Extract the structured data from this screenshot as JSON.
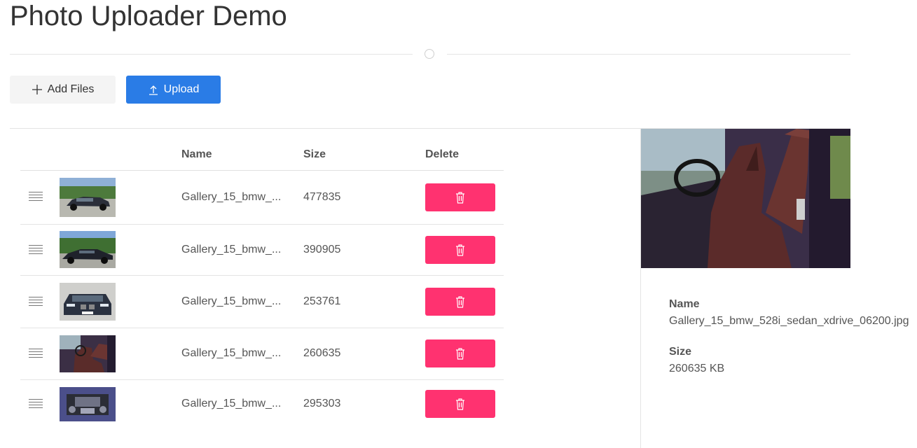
{
  "page": {
    "title": "Photo Uploader Demo"
  },
  "toolbar": {
    "add_label": "Add Files",
    "upload_label": "Upload"
  },
  "table": {
    "headers": {
      "name": "Name",
      "size": "Size",
      "delete": "Delete"
    },
    "rows": [
      {
        "name": "Gallery_15_bmw_...",
        "size": "477835",
        "thumb": "car-exterior-front-three-quarter"
      },
      {
        "name": "Gallery_15_bmw_...",
        "size": "390905",
        "thumb": "car-exterior-side"
      },
      {
        "name": "Gallery_15_bmw_...",
        "size": "253761",
        "thumb": "car-front-grille"
      },
      {
        "name": "Gallery_15_bmw_...",
        "size": "260635",
        "thumb": "car-interior-seats"
      },
      {
        "name": "Gallery_15_bmw_...",
        "size": "295303",
        "thumb": "car-engine-bay"
      }
    ]
  },
  "detail": {
    "name_label": "Name",
    "name_value": "Gallery_15_bmw_528i_sedan_xdrive_06200.jpg",
    "size_label": "Size",
    "size_value": "260635 KB"
  },
  "icons": {
    "add": "plus-icon",
    "upload": "upload-arrow-icon",
    "delete": "trash-icon",
    "drag": "drag-handle-icon"
  },
  "colors": {
    "upload_button": "#2a7ce6",
    "delete_button": "#ff3270",
    "add_button": "#f4f4f4"
  }
}
